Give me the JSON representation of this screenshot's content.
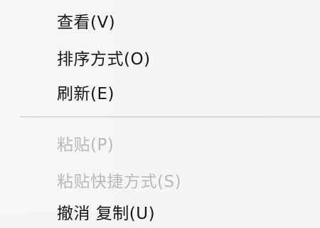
{
  "context_menu": {
    "items": [
      {
        "label": "查看(V)",
        "disabled": false
      },
      {
        "label": "排序方式(O)",
        "disabled": false
      },
      {
        "label": "刷新(E)",
        "disabled": false
      },
      {
        "label": "粘贴(P)",
        "disabled": true
      },
      {
        "label": "粘贴快捷方式(S)",
        "disabled": true
      },
      {
        "label": "撤消 复制(U)",
        "disabled": false
      }
    ]
  }
}
